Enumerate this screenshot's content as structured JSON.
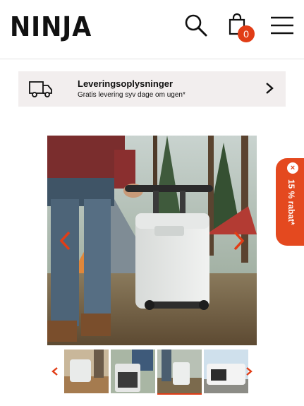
{
  "header": {
    "brand": "NINJA",
    "cart_count": "0"
  },
  "delivery": {
    "title": "Leveringsoplysninger",
    "subtitle": "Gratis levering syv dage om ugen*"
  },
  "discount_tab": {
    "label": "15 % rabat*",
    "close": "×"
  },
  "gallery": {
    "thumbnail_count": 4,
    "active_thumbnail": 3
  },
  "colors": {
    "accent": "#e13d16",
    "banner_bg": "#f2eeee",
    "discount_bg": "#e4491f"
  },
  "icons": [
    "search-icon",
    "shopping-bag-icon",
    "hamburger-menu-icon",
    "truck-icon",
    "chevron-right-icon",
    "chevron-left-icon",
    "close-icon"
  ]
}
